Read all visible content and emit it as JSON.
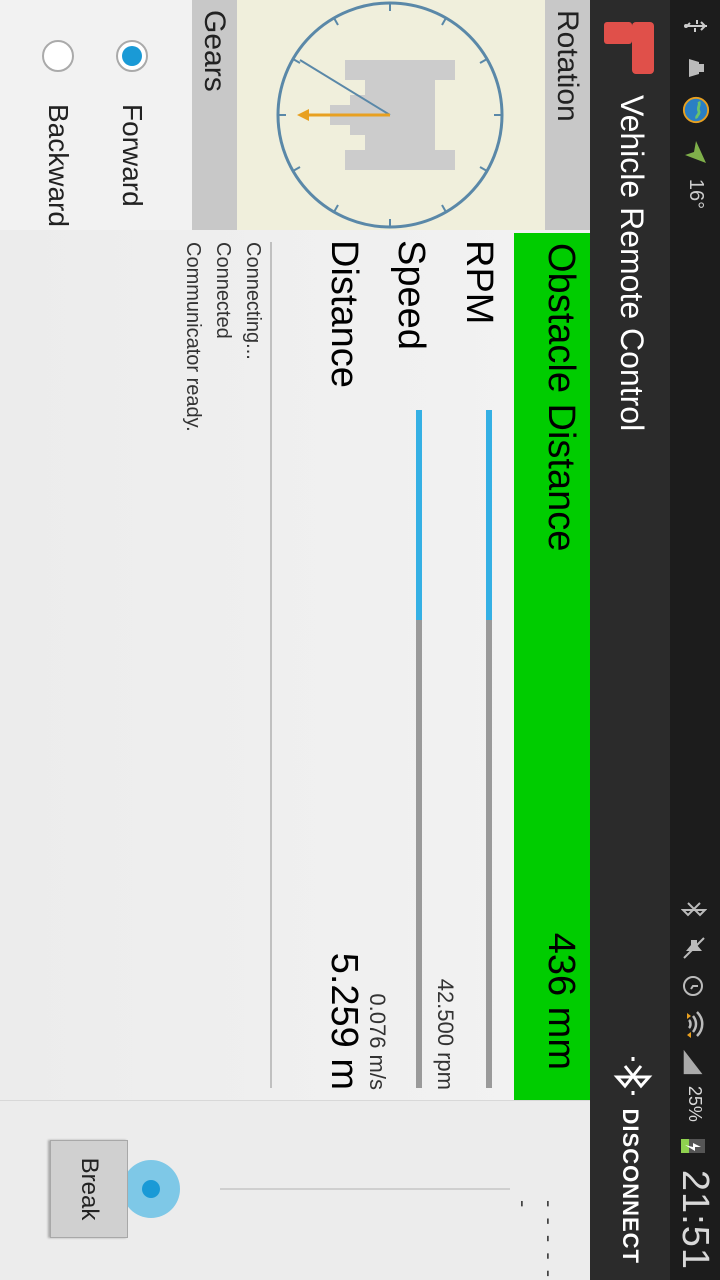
{
  "status_bar": {
    "time": "21:51",
    "battery": "25%",
    "temperature": "16°",
    "icons": [
      "usb-icon",
      "notification-icon",
      "globe-icon",
      "navigation-icon",
      "bluetooth-icon",
      "mute-icon",
      "alarm-icon",
      "wifi-icon",
      "signal-icon",
      "battery-icon"
    ]
  },
  "app": {
    "title": "Vehicle Remote Control",
    "disconnect_label": "DISCONNECT",
    "accent": "#00cc00"
  },
  "rotation": {
    "header": "Rotation"
  },
  "gears": {
    "header": "Gears",
    "options": [
      {
        "label": "Forward",
        "selected": true
      },
      {
        "label": "Backward",
        "selected": false
      }
    ]
  },
  "obstacle": {
    "label": "Obstacle Distance",
    "value": "436 mm"
  },
  "rpm": {
    "label": "RPM",
    "value": "42.500 rpm",
    "level": 0.31
  },
  "speed": {
    "label": "Speed",
    "value": "0.076 m/s",
    "level": 0.31
  },
  "distance": {
    "label": "Distance",
    "value": "5.259 m"
  },
  "log": [
    "Connecting...",
    "Connected",
    "Communicator ready."
  ],
  "control": {
    "dashes": "- - - - - -",
    "break_label": "Break"
  }
}
